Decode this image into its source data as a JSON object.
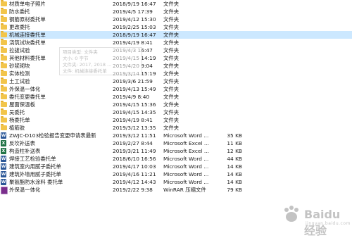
{
  "files": [
    {
      "icon": "folder",
      "name": "材质单电子照片",
      "date": "2018/9/19 16:47",
      "type": "文件夹",
      "size": ""
    },
    {
      "icon": "folder",
      "name": "防水委托",
      "date": "2019/4/5 17:39",
      "type": "文件夹",
      "size": ""
    },
    {
      "icon": "folder",
      "name": "钢筋原材委托单",
      "date": "2019/4/12 15:30",
      "type": "文件夹",
      "size": ""
    },
    {
      "icon": "folder",
      "name": "更改委托",
      "date": "2019/2/25 15:03",
      "type": "文件夹",
      "size": ""
    },
    {
      "icon": "folder",
      "name": "机械连接委托单",
      "date": "2018/9/19 16:47",
      "type": "文件夹",
      "size": ""
    },
    {
      "icon": "folder",
      "name": "浇筑试块委托单",
      "date": "2019/4/19 8:41",
      "type": "文件夹",
      "size": ""
    },
    {
      "icon": "folder",
      "name": "拉拔试验",
      "date": "2019/4/3 16:47",
      "type": "文件夹",
      "size": ""
    },
    {
      "icon": "folder",
      "name": "其他材料委托单",
      "date": "2019/4/15 14:19",
      "type": "文件夹",
      "size": ""
    },
    {
      "icon": "folder",
      "name": "砂浆砌块",
      "date": "2019/4/20 9:04",
      "type": "文件夹",
      "size": ""
    },
    {
      "icon": "folder",
      "name": "实体检测",
      "date": "2019/3/14 15:19",
      "type": "文件夹",
      "size": ""
    },
    {
      "icon": "folder",
      "name": "土工试验",
      "date": "2019/3/6 21:59",
      "type": "文件夹",
      "size": ""
    },
    {
      "icon": "folder",
      "name": "外保温一体化",
      "date": "2019/4/13 15:49",
      "type": "文件夹",
      "size": ""
    },
    {
      "icon": "folder",
      "name": "委托变更委托单",
      "date": "2019/4/9 8:40",
      "type": "文件夹",
      "size": ""
    },
    {
      "icon": "folder",
      "name": "屋面保温板",
      "date": "2019/4/15 15:36",
      "type": "文件夹",
      "size": ""
    },
    {
      "icon": "folder",
      "name": "吴委托",
      "date": "2019/4/15 14:35",
      "type": "文件夹",
      "size": ""
    },
    {
      "icon": "folder",
      "name": "杨委托单",
      "date": "2019/4/19 8:41",
      "type": "文件夹",
      "size": ""
    },
    {
      "icon": "folder",
      "name": "植筋胶",
      "date": "2019/3/12 13:35",
      "type": "文件夹",
      "size": ""
    },
    {
      "icon": "word",
      "name": "ZWJC-D103检验报告变更申请表最新",
      "date": "2019/3/12 11:51",
      "type": "Microsoft Word ...",
      "size": "35 KB"
    },
    {
      "icon": "excel",
      "name": "反坎补送表",
      "date": "2019/2/27 8:44",
      "type": "Microsoft Excel ...",
      "size": "11 KB"
    },
    {
      "icon": "excel",
      "name": "构造柱补送表",
      "date": "2019/3/21 11:49",
      "type": "Microsoft Excel ...",
      "size": "12 KB"
    },
    {
      "icon": "word",
      "name": "焊接工艺检验委托单",
      "date": "2018/6/10 16:56",
      "type": "Microsoft Word ...",
      "size": "44 KB"
    },
    {
      "icon": "word",
      "name": "建筑室内用腻子委托单",
      "date": "2019/4/17 10:03",
      "type": "Microsoft Word ...",
      "size": "14 KB"
    },
    {
      "icon": "word",
      "name": "建筑外墙用腻子委托单",
      "date": "2019/4/16 11:21",
      "type": "Microsoft Word ...",
      "size": "14 KB"
    },
    {
      "icon": "word",
      "name": "聚氨酯防水涂料 委托单",
      "date": "2019/4/12 14:43",
      "type": "Microsoft Word ...",
      "size": "14 KB"
    },
    {
      "icon": "rar",
      "name": "外保温一体化",
      "date": "2019/2/22 9:38",
      "type": "WinRAR 压缩文件",
      "size": "79 KB"
    }
  ],
  "selected_index": 4,
  "tooltip": {
    "lines": [
      "项目类型: 文件夹",
      "大小: 0 字节",
      "文件夹: 2017, 2018 ...",
      "文件: 机械连接委托单"
    ]
  },
  "watermark": {
    "text": "Baidu经验",
    "sub": "jingyan.baidu.com"
  },
  "colors": {
    "folder": "#f2c54b",
    "selected": "#cce8ff",
    "word": "#2b5797",
    "excel": "#217346",
    "rar": "#7a2e8c"
  }
}
